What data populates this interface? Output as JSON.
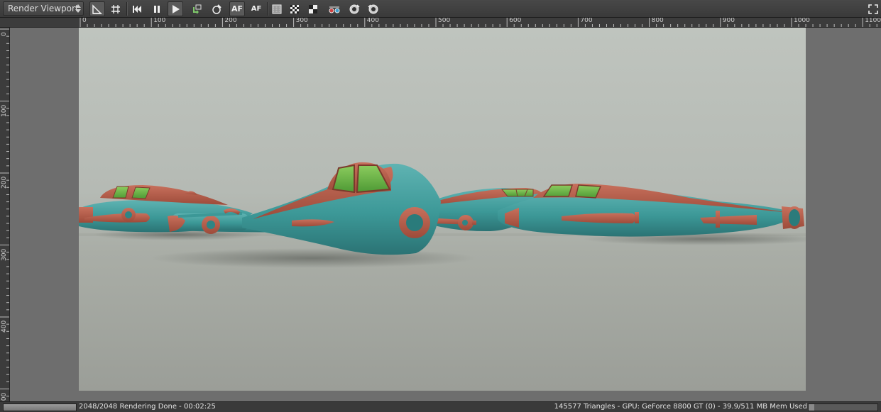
{
  "toolbar": {
    "viewport_select": "Render Viewport",
    "buttons": [
      {
        "name": "region-tool-icon"
      },
      {
        "name": "grid-icon"
      },
      {
        "name": "restart-icon"
      },
      {
        "name": "pause-icon"
      },
      {
        "name": "play-icon"
      },
      {
        "name": "refresh-scene-icon"
      },
      {
        "name": "material-picker-icon"
      },
      {
        "name": "autofocus-icon",
        "label": "AF"
      },
      {
        "name": "autofocus-pick-icon",
        "label": "AF"
      },
      {
        "name": "noise-pattern-icon"
      },
      {
        "name": "checker-icon"
      },
      {
        "name": "checker-large-icon"
      },
      {
        "name": "stereo-glasses-icon"
      },
      {
        "name": "camera-rotate-icon"
      },
      {
        "name": "camera-rotate-alt-icon"
      },
      {
        "name": "fullscreen-icon"
      }
    ]
  },
  "ruler": {
    "horizontal": [
      "0",
      "100",
      "200",
      "300",
      "400",
      "500",
      "600",
      "700",
      "800",
      "900",
      "1000",
      "1100"
    ],
    "vertical": [
      "0",
      "100",
      "200",
      "300",
      "400",
      "500"
    ]
  },
  "status": {
    "left": "2048/2048 Rendering Done - 00:02:25",
    "right": "145577 Triangles - GPU: GeForce 8800 GT (0) - 39.9/511 MB Mem Used",
    "progress": 1.0,
    "memory_fraction": 0.078
  },
  "colors": {
    "hull": "#3f9c9c",
    "trim": "#b85c49",
    "canopy_glass": "#6fb04a",
    "background": "#bfc4be"
  }
}
